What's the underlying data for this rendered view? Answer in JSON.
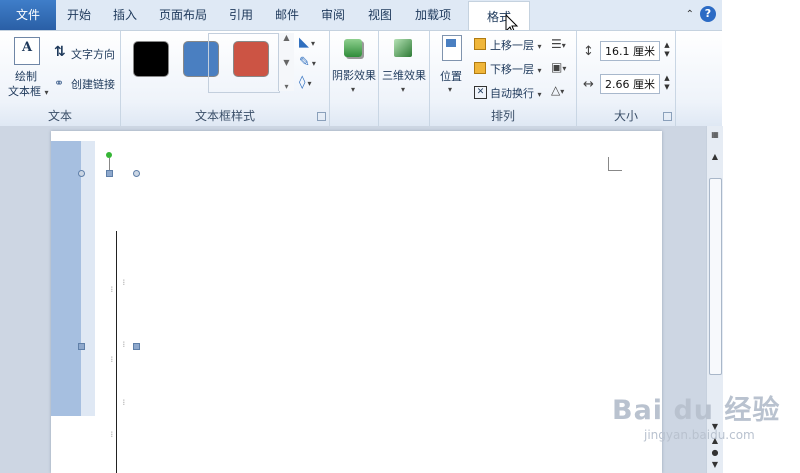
{
  "tabs": [
    "文件",
    "开始",
    "插入",
    "页面布局",
    "引用",
    "邮件",
    "审阅",
    "视图",
    "加载项",
    "格式"
  ],
  "ribbon": {
    "text_group": {
      "label": "文本",
      "draw_textbox_line1": "绘制",
      "draw_textbox_line2": "文本框",
      "text_direction": "文字方向",
      "create_link": "创建链接"
    },
    "textbox_styles_group": {
      "label": "文本框样式",
      "swatches": [
        "#000000",
        "#4a7fc1",
        "#cc5444"
      ]
    },
    "shadow_effects_group": {
      "label": "阴影效果"
    },
    "threed_effects_group": {
      "label": "三维效果"
    },
    "arrange_group": {
      "label": "排列",
      "position": "位置",
      "bring_forward": "上移一层",
      "send_backward": "下移一层",
      "wrap_text": "自动换行"
    },
    "size_group": {
      "label": "大小",
      "height": "16.1 厘米",
      "width": "2.66 厘米"
    }
  },
  "watermark": {
    "main": "Bai du 经验",
    "sub": "jingyan.baidu.com"
  }
}
